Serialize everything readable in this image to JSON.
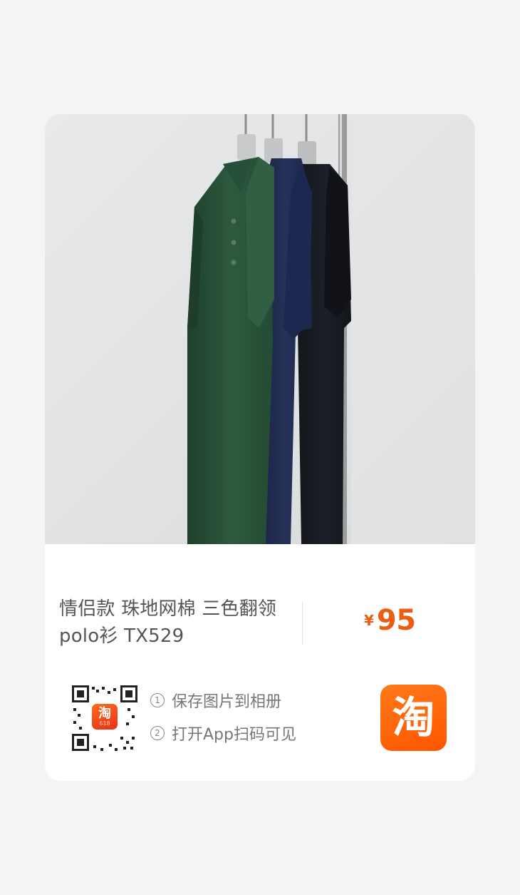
{
  "product": {
    "title_line1": "情侣款 珠地网棉 三色翻领",
    "title_line2": "polo衫 TX529",
    "price_currency": "¥",
    "price_amount": "95"
  },
  "share": {
    "step1_num": "1",
    "step1_text": "保存图片到相册",
    "step2_num": "2",
    "step2_text": "打开App扫码可见",
    "qr_center_badge": "淘",
    "qr_center_badge_sub": "618"
  },
  "brand": {
    "logo_glyph": "淘",
    "accent_color": "#ff5500",
    "price_color": "#ea5d13"
  },
  "icons": {
    "qr": "qr-code-icon",
    "taobao": "taobao-logo-icon"
  }
}
